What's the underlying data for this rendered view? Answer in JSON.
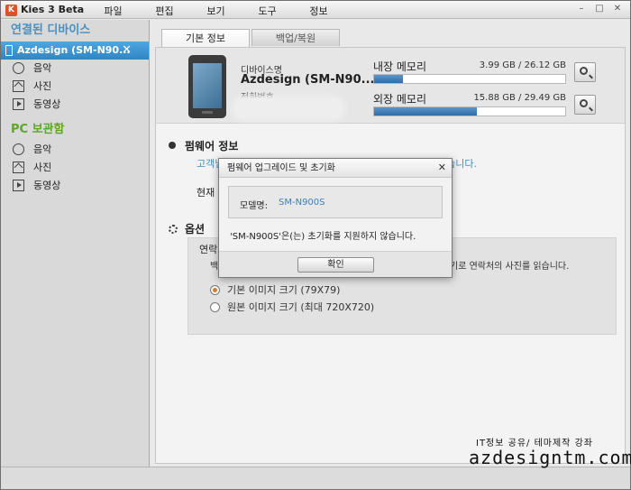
{
  "app": {
    "title": "Kies 3 Beta",
    "logo_letter": "K"
  },
  "menu": [
    "파일",
    "편집",
    "보기",
    "도구",
    "정보"
  ],
  "window_controls": [
    "–",
    "□",
    "✕"
  ],
  "sidebar": {
    "connected_header": "연결된 디바이스",
    "device_name": "Azdesign (SM-N90...",
    "device_items": [
      "음악",
      "사진",
      "동영상"
    ],
    "pc_header": "PC 보관함",
    "pc_items": [
      "음악",
      "사진",
      "동영상"
    ]
  },
  "tabs": [
    "기본 정보",
    "백업/복원"
  ],
  "device": {
    "label": "디바이스명",
    "name": "Azdesign (SM-N90...",
    "phone_label": "전화번호"
  },
  "memory": {
    "internal": {
      "name": "내장 메모리",
      "value": "3.99 GB / 26.12 GB",
      "fraction": 0.153
    },
    "external": {
      "name": "외장 메모리",
      "value": "15.88 GB / 29.49 GB",
      "fraction": 0.538
    }
  },
  "firmware": {
    "title": "펌웨어 정보",
    "link_left": "고객님",
    "link_right": "않습니다.",
    "current_label": "현재 펌"
  },
  "options": {
    "title": "옵션",
    "sub_label": "연락처",
    "desc_left": "백업",
    "desc_right": "기로 연락처의 사진를 읽습니다.",
    "radio1": "기본 이미지 크기 (79X79)",
    "radio2": "원본 이미지 크기 (최대 720X720)"
  },
  "dialog": {
    "title": "펌웨어 업그레이드 및 초기화",
    "close": "✕",
    "model_label": "모델명:",
    "model_value": "SM-N900S",
    "message": "'SM-N900S'은(는) 초기화를 지원하지 않습니다.",
    "ok": "확인"
  },
  "watermark": {
    "line1": "IT정보 공유/ 테마제작 강좌",
    "line2": "azdesigntm.com"
  }
}
